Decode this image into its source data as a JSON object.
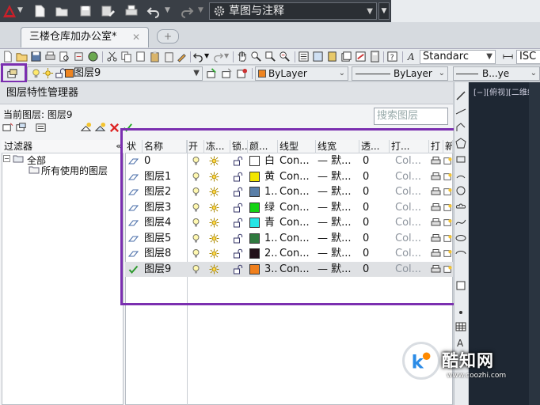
{
  "titlebar": {
    "workspace": "草图与注释",
    "quick_access": [
      "new-icon",
      "open-icon",
      "save-icon",
      "saveas-icon",
      "print-icon",
      "undo-icon",
      "redo-icon"
    ]
  },
  "tab": {
    "doc_title": "三楼仓库加办公室*",
    "close_glyph": "✕",
    "new_tab_glyph": "+"
  },
  "toolbar1": {
    "text_style": "Standarc",
    "dim_style": "ISC"
  },
  "toolbar2": {
    "layer_name": "图层9",
    "color": "ByLayer",
    "linetype": "ByLayer",
    "lineweight": "B...ye"
  },
  "panel": {
    "title": "图层特性管理器",
    "current_layer": "当前图层: 图层9",
    "search_placeholder": "搜索图层",
    "filter_header": "过滤器",
    "collapse_glyph": "«",
    "tree_all": "全部",
    "tree_used": "所有使用的图层"
  },
  "table": {
    "columns": [
      "状",
      "名称",
      "开",
      "冻...",
      "锁...",
      "颜...",
      "线型",
      "线宽",
      "透...",
      "打...",
      "打",
      "新"
    ],
    "rows": [
      {
        "status": "current-layer-icon",
        "name": "0",
        "color_name": "白",
        "color": "#ffffff",
        "linetype": "Con...",
        "lineweight": "— 默...",
        "transparency": "0",
        "plotstyle": "Col..."
      },
      {
        "status": "layer-icon",
        "name": "图层1",
        "color_name": "黄",
        "color": "#f2e600",
        "linetype": "Con...",
        "lineweight": "— 默...",
        "transparency": "0",
        "plotstyle": "Col..."
      },
      {
        "status": "layer-icon",
        "name": "图层2",
        "color_name": "1...",
        "color": "#5a7fa8",
        "linetype": "Con...",
        "lineweight": "— 默...",
        "transparency": "0",
        "plotstyle": "Col..."
      },
      {
        "status": "layer-icon",
        "name": "图层3",
        "color_name": "绿",
        "color": "#12d312",
        "linetype": "Con...",
        "lineweight": "— 默...",
        "transparency": "0",
        "plotstyle": "Col..."
      },
      {
        "status": "layer-icon",
        "name": "图层4",
        "color_name": "青",
        "color": "#25e6e6",
        "linetype": "Con...",
        "lineweight": "— 默...",
        "transparency": "0",
        "plotstyle": "Col..."
      },
      {
        "status": "layer-icon",
        "name": "图层5",
        "color_name": "1...",
        "color": "#2f7a3f",
        "linetype": "Con...",
        "lineweight": "— 默...",
        "transparency": "0",
        "plotstyle": "Col..."
      },
      {
        "status": "layer-icon",
        "name": "图层8",
        "color_name": "2...",
        "color": "#221018",
        "linetype": "Con...",
        "lineweight": "— 默...",
        "transparency": "0",
        "plotstyle": "Col..."
      },
      {
        "status": "check-icon",
        "name": "图层9",
        "color_name": "3...",
        "color": "#f07f1c",
        "linetype": "Con...",
        "lineweight": "— 默...",
        "transparency": "0",
        "plotstyle": "Col...",
        "selected": true
      }
    ]
  },
  "drawing": {
    "view_label": "[−][俯视][二维线框]"
  },
  "watermark": {
    "brand": "酷知网",
    "url": "www.coozhi.com"
  },
  "colors": {
    "highlight": "#7b2fb0",
    "titlebar": "#3a3f46",
    "drawing_bg": "#1e2733"
  }
}
